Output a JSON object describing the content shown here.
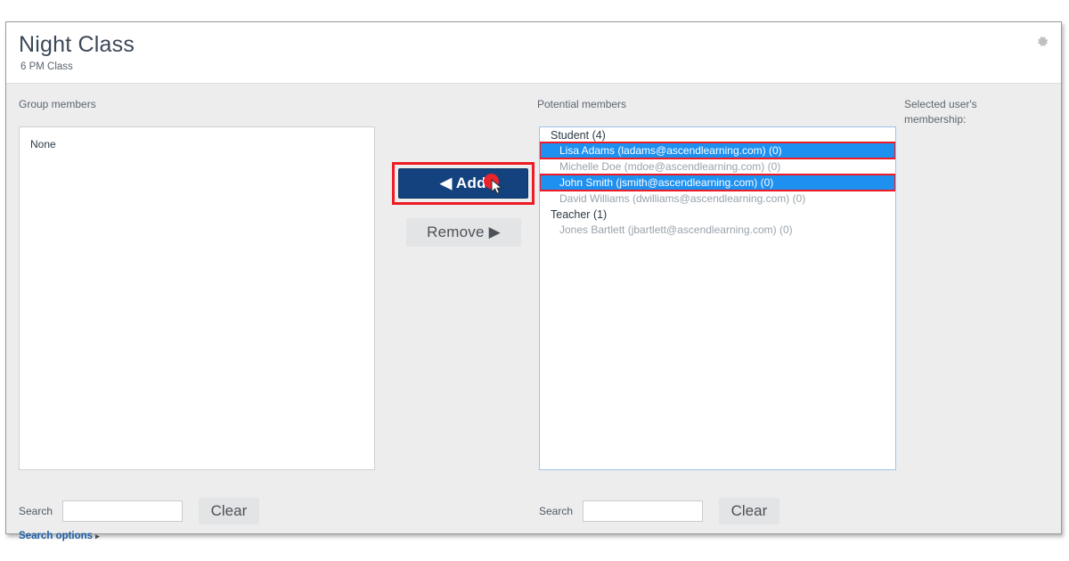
{
  "header": {
    "title": "Night Class",
    "subtitle": "6 PM Class",
    "gear_icon": "gear-icon"
  },
  "columns": {
    "group_members_label": "Group members",
    "potential_members_label": "Potential members",
    "selected_membership_label": "Selected user's membership:"
  },
  "group_members": {
    "empty_text": "None"
  },
  "potential_members": {
    "groups": [
      {
        "name": "Student (4)",
        "items": [
          {
            "label": "Lisa Adams (ladams@ascendlearning.com) (0)",
            "selected": true,
            "annotated": true
          },
          {
            "label": "Michelle Doe (mdoe@ascendlearning.com) (0)",
            "selected": false,
            "annotated": false
          },
          {
            "label": "John Smith (jsmith@ascendlearning.com) (0)",
            "selected": true,
            "annotated": true
          },
          {
            "label": "David Williams (dwilliams@ascendlearning.com) (0)",
            "selected": false,
            "annotated": false
          }
        ]
      },
      {
        "name": "Teacher (1)",
        "items": [
          {
            "label": "Jones Bartlett (jbartlett@ascendlearning.com) (0)",
            "selected": false,
            "annotated": false
          }
        ]
      }
    ]
  },
  "buttons": {
    "add_label": "◀ Add",
    "remove_label": "Remove ▶"
  },
  "left_search": {
    "label": "Search",
    "value": "",
    "placeholder": "",
    "clear_label": "Clear"
  },
  "right_search": {
    "label": "Search",
    "value": "",
    "placeholder": "",
    "clear_label": "Clear"
  },
  "search_options": {
    "label": "Search options",
    "caret": "▸"
  },
  "colors": {
    "accent_button": "#14427e",
    "selection": "#1e90f0",
    "annotation": "#ee1b24",
    "link": "#1d5fa8",
    "body_background": "#ededed"
  }
}
